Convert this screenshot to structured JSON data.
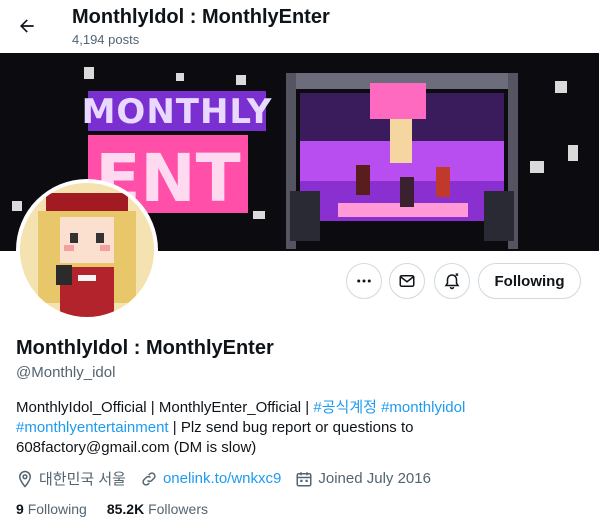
{
  "header": {
    "title": "MonthlyIdol : MonthlyEnter",
    "posts": "4,194 posts"
  },
  "banner": {
    "logo_top": "MONTHLY",
    "logo_bottom": "ENT",
    "colors": {
      "bg": "#0b0b10",
      "purple": "#9b3cf0",
      "pink": "#ff4fa8"
    }
  },
  "profile": {
    "name": "MonthlyIdol : MonthlyEnter",
    "handle": "@Monthly_idol",
    "follow_label": "Following",
    "bio": {
      "text1": "MonthlyIdol_Official | MonthlyEnter_Official | ",
      "tag1": "#공식계정",
      "tag2": "#monthlyidol",
      "tag3": "#monthlyentertainment",
      "text2": " | Plz send bug  report or questions to",
      "text3": "608factory@gmail.com (DM is slow)"
    },
    "location": "대한민국 서울",
    "website": "onelink.to/wnkxc9",
    "joined": "Joined July 2016",
    "following_count": "9",
    "following_label": "Following",
    "followers_count": "85.2K",
    "followers_label": "Followers"
  },
  "icons": [
    "back-arrow-icon",
    "more-icon",
    "message-icon",
    "notification-bell-icon",
    "location-icon",
    "link-icon",
    "calendar-icon"
  ],
  "colors": {
    "link": "#1d9bf0",
    "muted": "#536471",
    "text": "#0f1419",
    "border": "#cfd9de"
  }
}
